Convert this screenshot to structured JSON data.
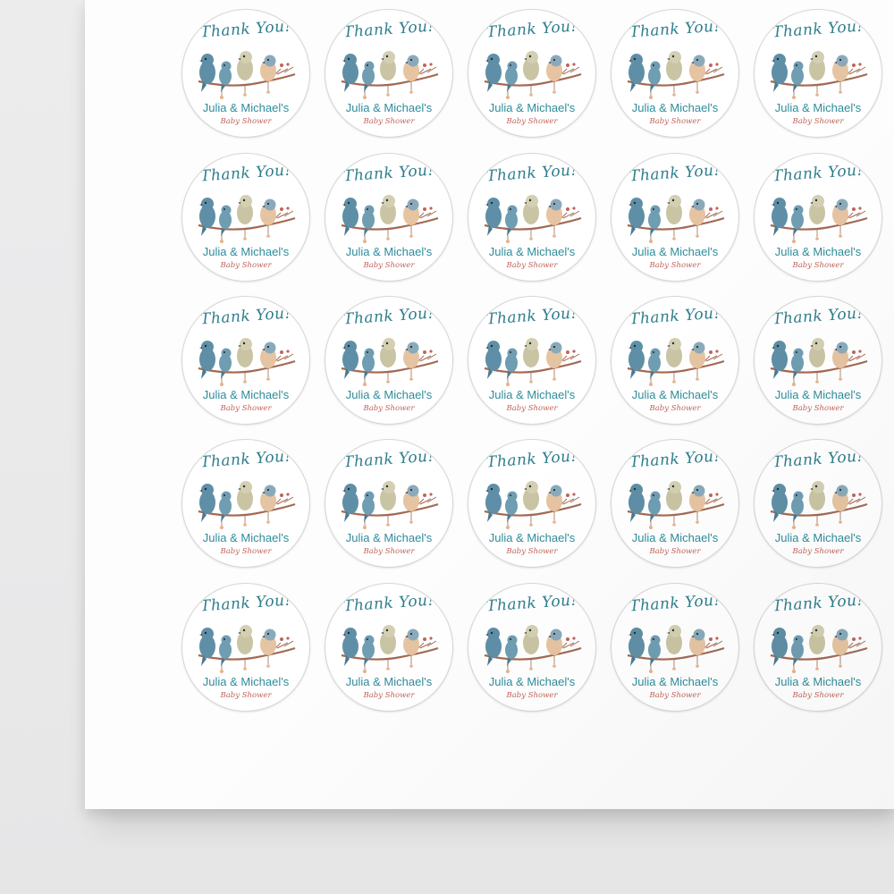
{
  "sticker": {
    "thanks": "Thank You!",
    "names": "Julia & Michael's",
    "occasion": "Baby Shower"
  },
  "sheet": {
    "rows": 5,
    "columns": 5
  },
  "colors": {
    "title_teal": "#2f7e8d",
    "names_teal": "#2f8c9b",
    "occasion_red": "#c0645a",
    "bird_blue": "#5f8fa6",
    "bird_cream": "#c9c4a3",
    "bird_peach": "#e6c4a2",
    "branch": "#a26a52"
  },
  "icons": [
    "bird-illustration"
  ]
}
